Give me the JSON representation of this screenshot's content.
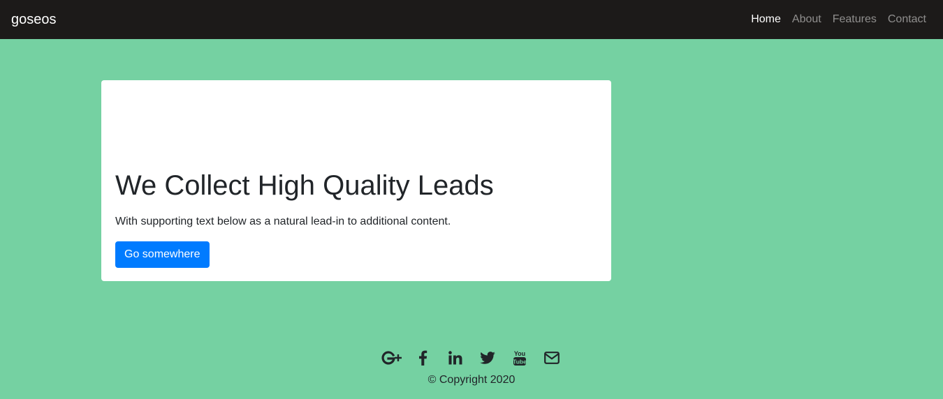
{
  "navbar": {
    "brand": "goseos",
    "links": [
      {
        "label": "Home",
        "active": true
      },
      {
        "label": "About",
        "active": false
      },
      {
        "label": "Features",
        "active": false
      },
      {
        "label": "Contact",
        "active": false
      }
    ]
  },
  "card": {
    "title": "We Collect High Quality Leads",
    "text": "With supporting text below as a natural lead-in to additional content.",
    "button_label": "Go somewhere"
  },
  "footer": {
    "social_icons": [
      "google-plus-icon",
      "facebook-icon",
      "linkedin-icon",
      "twitter-icon",
      "youtube-icon",
      "envelope-icon"
    ],
    "copyright": "© Copyright 2020"
  },
  "colors": {
    "background": "#75d1a2",
    "navbar": "#1c1a19",
    "button": "#007bff"
  }
}
